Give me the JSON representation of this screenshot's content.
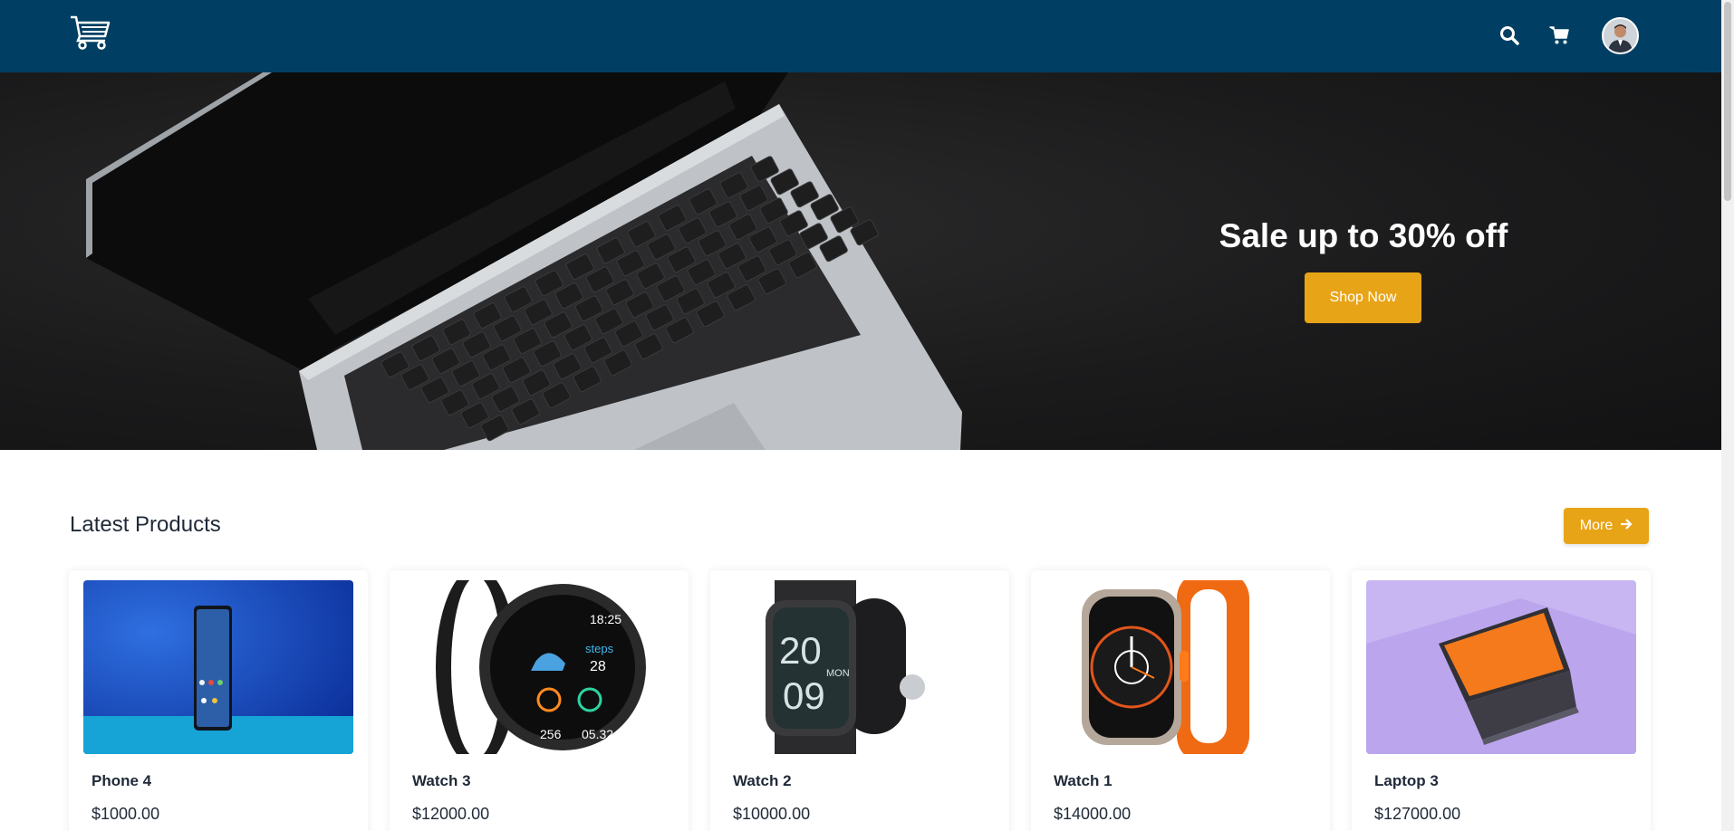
{
  "nav": {
    "logo": "cart-logo-icon",
    "icons": [
      "search-icon",
      "cart-icon"
    ],
    "avatar": "user-avatar"
  },
  "hero": {
    "title": "Sale up to 30% off",
    "button_label": "Shop Now"
  },
  "section": {
    "title": "Latest Products",
    "more_label": "More"
  },
  "products": [
    {
      "name": "Phone 4",
      "price": "$1000.00"
    },
    {
      "name": "Watch 3",
      "price": "$12000.00"
    },
    {
      "name": "Watch 2",
      "price": "$10000.00"
    },
    {
      "name": "Watch 1",
      "price": "$14000.00"
    },
    {
      "name": "Laptop 3",
      "price": "$127000.00"
    }
  ],
  "colors": {
    "navbar": "#003f63",
    "accent": "#e8a417",
    "hero_bg": "#1b1b1c"
  }
}
